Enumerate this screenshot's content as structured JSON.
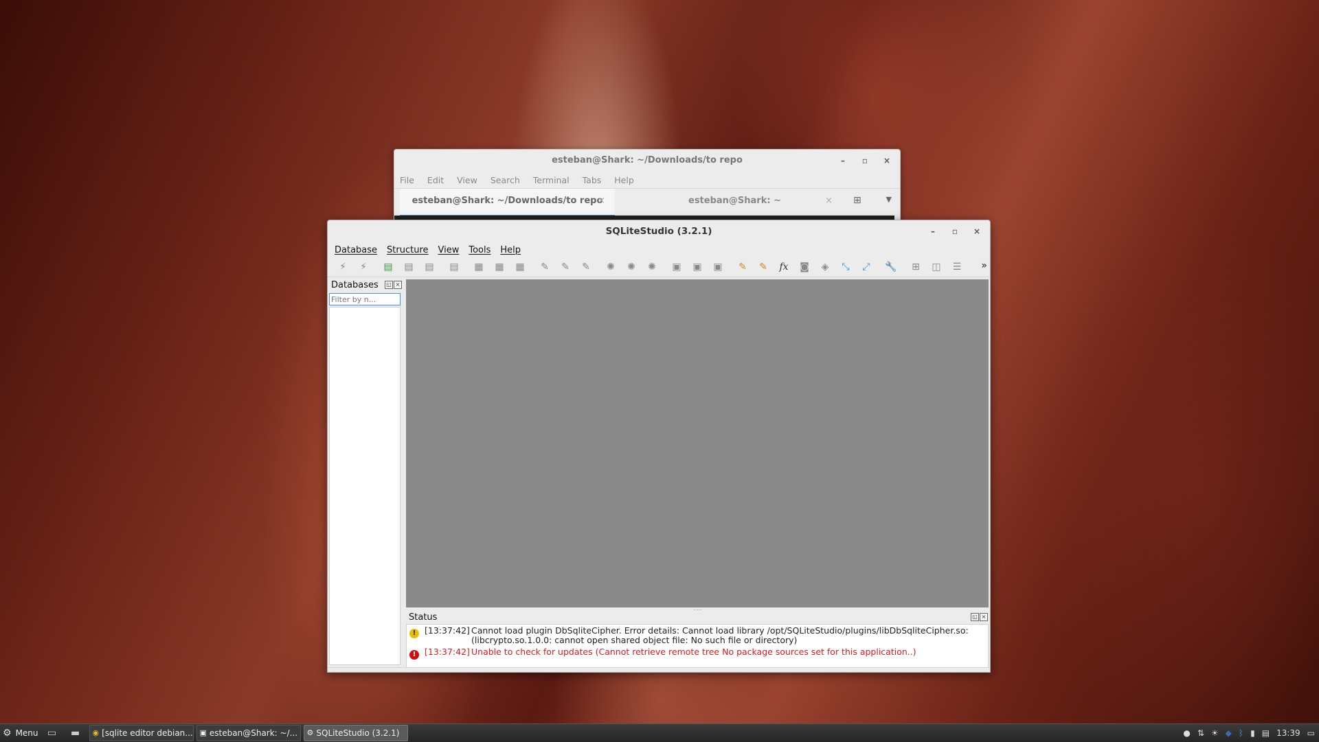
{
  "terminal": {
    "title": "esteban@Shark: ~/Downloads/to repo",
    "menu": [
      "File",
      "Edit",
      "View",
      "Search",
      "Terminal",
      "Tabs",
      "Help"
    ],
    "tabs": [
      {
        "label": "esteban@Shark: ~/Downloads/to repo",
        "active": true
      },
      {
        "label": "esteban@Shark: ~",
        "active": false
      }
    ]
  },
  "sqlitestudio": {
    "title": "SQLiteStudio (3.2.1)",
    "menu": [
      "Database",
      "Structure",
      "View",
      "Tools",
      "Help"
    ],
    "toolbar_icons": [
      "connect-icon",
      "disconnect-icon",
      "add-database-icon",
      "edit-database-icon",
      "remove-database-icon",
      "refresh-icon",
      "create-table-icon",
      "edit-table-icon",
      "delete-table-icon",
      "create-index-icon",
      "edit-index-icon",
      "delete-index-icon",
      "create-trigger-icon",
      "edit-trigger-icon",
      "delete-trigger-icon",
      "create-view-icon",
      "edit-view-icon",
      "delete-view-icon",
      "sql-editor-icon",
      "ddl-history-icon",
      "functions-icon",
      "collations-icon",
      "extensions-icon",
      "import-icon",
      "export-icon",
      "config-icon",
      "tile-icon",
      "tile-horizontal-icon",
      "cascade-icon"
    ],
    "databases_panel": {
      "title": "Databases",
      "filter_placeholder": "Filter by n..."
    },
    "status_panel": {
      "title": "Status",
      "messages": [
        {
          "type": "warning",
          "time": "[13:37:42]",
          "text": "Cannot load plugin DbSqliteCipher. Error details: Cannot load library /opt/SQLiteStudio/plugins/libDbSqliteCipher.so: (libcrypto.so.1.0.0: cannot open shared object file: No such file or directory)"
        },
        {
          "type": "error",
          "time": "[13:37:42]",
          "text": "Unable to check for updates (Cannot retrieve remote tree No package sources set for this application..)"
        }
      ]
    }
  },
  "taskbar": {
    "menu_label": "Menu",
    "tasks": [
      {
        "label": "[sqlite editor debian...",
        "active": false
      },
      {
        "label": "esteban@Shark: ~/...",
        "active": false
      },
      {
        "label": "SQLiteStudio (3.2.1)",
        "active": true
      }
    ],
    "clock": "13:39"
  }
}
